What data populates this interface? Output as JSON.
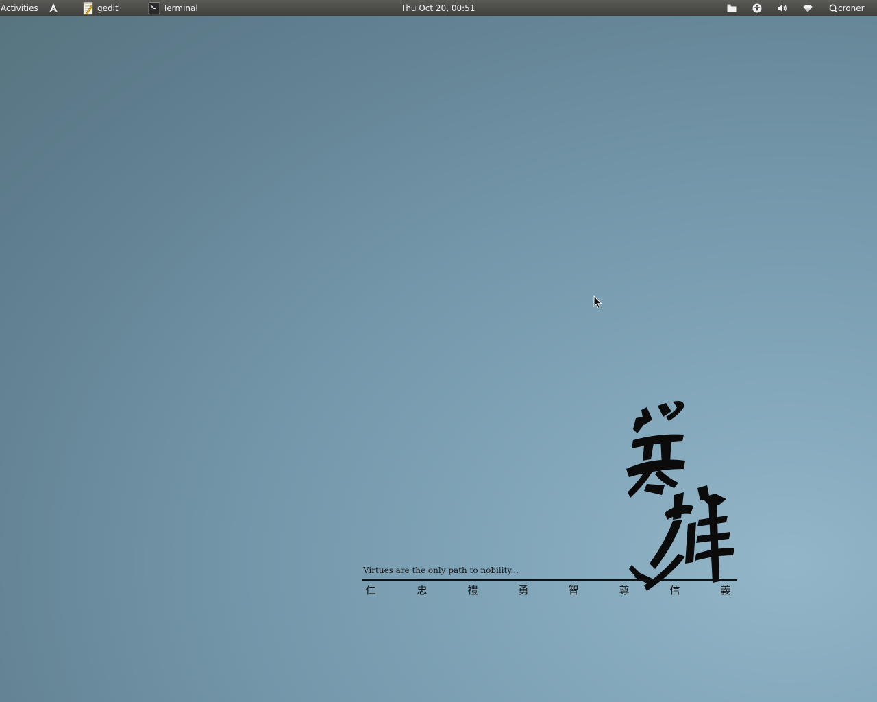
{
  "topbar": {
    "activities_label": "Activities",
    "logo_icon": "arch-linux-logo-icon",
    "tasks": [
      {
        "label": "gedit",
        "icon": "gedit-icon"
      },
      {
        "label": "Terminal",
        "icon": "terminal-icon"
      }
    ],
    "clock": "Thu Oct 20, 00:51",
    "indicators": [
      "files-icon",
      "accessibility-icon",
      "volume-icon",
      "wifi-icon"
    ],
    "user_label": "croner",
    "user_icon": "user-status-icon"
  },
  "wallpaper": {
    "tagline": "Virtues are the only path to nobility...",
    "virtues": [
      "仁",
      "忠",
      "禮",
      "勇",
      "智",
      "尊",
      "信",
      "義"
    ],
    "logo_icon": "calligraphy-hero-icon"
  },
  "colors": {
    "panel_bg": "#3f3f3c",
    "panel_text": "#f2f2f2",
    "wallpaper_light": "#93b6c8",
    "wallpaper_dark": "#57737f",
    "ink": "#111111"
  }
}
